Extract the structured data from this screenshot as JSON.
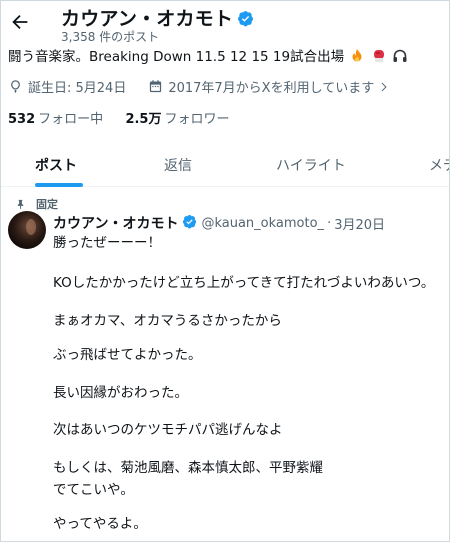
{
  "header": {
    "display_name": "カウアン・オカモト",
    "post_count": "3,358 件のポスト"
  },
  "profile": {
    "bio": "闘う音楽家。Breaking Down 11.5 12 15 19試合出場",
    "bio_emojis": [
      "fire-emoji",
      "boxing-glove-emoji",
      "headphones-emoji"
    ],
    "birthday": "誕生日: 5月24日",
    "joined": "2017年7月からXを利用しています",
    "following_count": "532",
    "following_label": "フォロー中",
    "followers_count": "2.5万",
    "followers_label": "フォロワー"
  },
  "tabs": [
    {
      "label": "ポスト",
      "active": true
    },
    {
      "label": "返信",
      "active": false
    },
    {
      "label": "ハイライト",
      "active": false
    },
    {
      "label": "メデ",
      "active": false
    }
  ],
  "tweet": {
    "pinned_label": "固定",
    "author_name": "カウアン・オカモト",
    "handle": "@kauan_okamoto_",
    "separator": "·",
    "date": "3月20日",
    "lines": [
      "勝ったぜーーー！",
      "KOしたかかったけど立ち上がってきて打たれづよいわあいつ。",
      "まぁオカマ、オカマうるさかったから",
      "ぶっ飛ばせてよかった。",
      "長い因縁がおわった。",
      "次はあいつのケツモチパパ逃げんなよ",
      "もしくは、菊池風磨、森本慎太郎、平野紫耀",
      "でてこいや。",
      "やってやるよ。"
    ]
  },
  "colors": {
    "accent": "#1d9bf0",
    "secondary_text": "#536471",
    "primary_text": "#0f1419"
  }
}
